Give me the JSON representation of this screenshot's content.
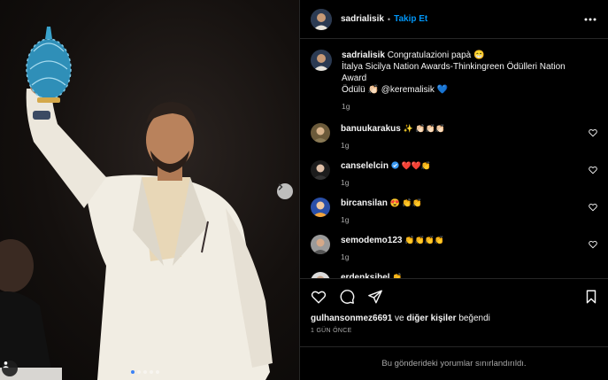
{
  "post": {
    "author": "sadrialisik",
    "follow_label": "Takip Et",
    "separator": "•",
    "caption_line1": "Congratulazioni papà 😁",
    "caption_line2": "İtalya Sicilya Nation Awards-Thinkingreen Ödülleri Nation Award",
    "caption_line3": "Ödülü 👏🏻 @keremalisik 💙",
    "caption_time": "1g"
  },
  "comments": [
    {
      "user": "banuukarakus",
      "text": "✨ 👏🏻👏🏻👏🏻",
      "time": "1g",
      "verified": false
    },
    {
      "user": "canselelcin",
      "text": "❤️❤️👏",
      "time": "1g",
      "verified": true
    },
    {
      "user": "bircansilan",
      "text": "😍 👏👏",
      "time": "1g",
      "verified": false
    },
    {
      "user": "semodemo123",
      "text": "👏👏👏👏",
      "time": "1g",
      "verified": false
    },
    {
      "user": "erdenksibel",
      "text": "👏",
      "time": "",
      "verified": false
    }
  ],
  "likes": {
    "user": "gulhansonmez6691",
    "connector": "ve",
    "others": "diğer kişiler",
    "suffix": "beğendi"
  },
  "date_label": "1 GÜN ÖNCE",
  "footer_text": "Bu gönderideki yorumlar sınırlandırıldı.",
  "carousel": {
    "count": 5,
    "active_index": 0
  },
  "colors": {
    "accent": "#0095f6",
    "verified": "#3897f0",
    "background": "#000000"
  }
}
